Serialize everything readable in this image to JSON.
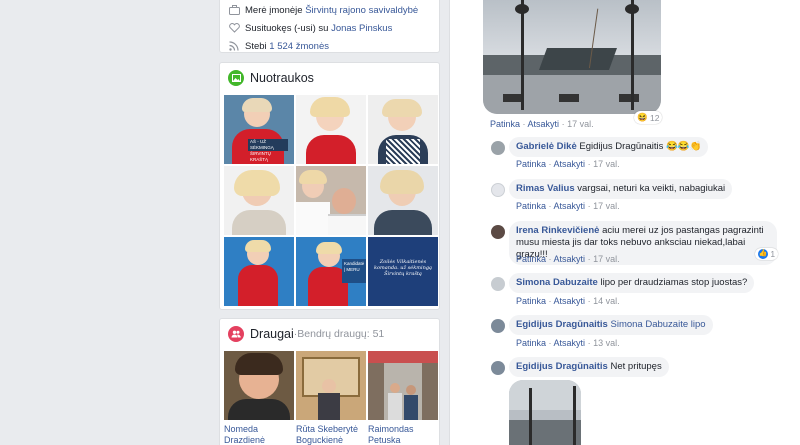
{
  "intro": {
    "work_prefix": "Merė įmonėje ",
    "work_link": "Širvintų rajono savivaldybė",
    "engaged_prefix": "Susituokęs (-usi) su ",
    "engaged_link": "Jonas Pinskus",
    "followers_prefix": "Stebi ",
    "followers_link": "1 524 žmonės"
  },
  "photos": {
    "title": "Nuotraukos",
    "overlay_text_1": "AŠ - UŽ SĖKMINGĄ ŠIRVINTŲ KRAŠTĄ",
    "overlay_text_2": "Kandidatė | MERU",
    "overlay_text_3": "Zoilės Vilkaitienės komanda. už sėkmingą Širvintų kraštą"
  },
  "friends": {
    "title": "Draugai",
    "separator": " · ",
    "subtitle": "Bendrų draugų: 51",
    "items": [
      {
        "name": "Nomeda Drazdienė"
      },
      {
        "name": "Rūta Skeberytė Boguckienė"
      },
      {
        "name": "Raimondas Petuska"
      }
    ]
  },
  "comment_actions": {
    "like": "Patinka",
    "reply": "Atsakyti",
    "sep": " · "
  },
  "top_reply": {
    "time": "17 val.",
    "reaction_count": "12"
  },
  "comments": [
    {
      "author": "Gabrielė Dikė",
      "text": "Egidijus Dragūnaitis 😂😂👏",
      "time": "17 val."
    },
    {
      "author": "Rimas Valius",
      "text": "vargsai, neturi ka veikti, nabagiukai",
      "time": "17 val."
    },
    {
      "author": "Irena Rinkevičienė",
      "text": "aciu merei uz jos pastangas pagrazinti musu miesta jis dar toks nebuvo anksciau niekad,labai grazu!!!",
      "time": "17 val.",
      "reaction_count": "1"
    },
    {
      "author": "Simona Dabuzaite",
      "text": "lipo per draudziamas stop juostas?",
      "time": "14 val."
    },
    {
      "author": "Egidijus Dragūnaitis",
      "text": "Simona Dabuzaite lipo",
      "time": "13 val."
    },
    {
      "author": "Egidijus Dragūnaitis",
      "text": "Net pritupęs"
    }
  ],
  "colors": {
    "link": "#385898",
    "meta": "#90949c",
    "bubble": "#f2f3f5",
    "photos_icon": "#42b72a",
    "friends_icon": "#e4405f"
  }
}
